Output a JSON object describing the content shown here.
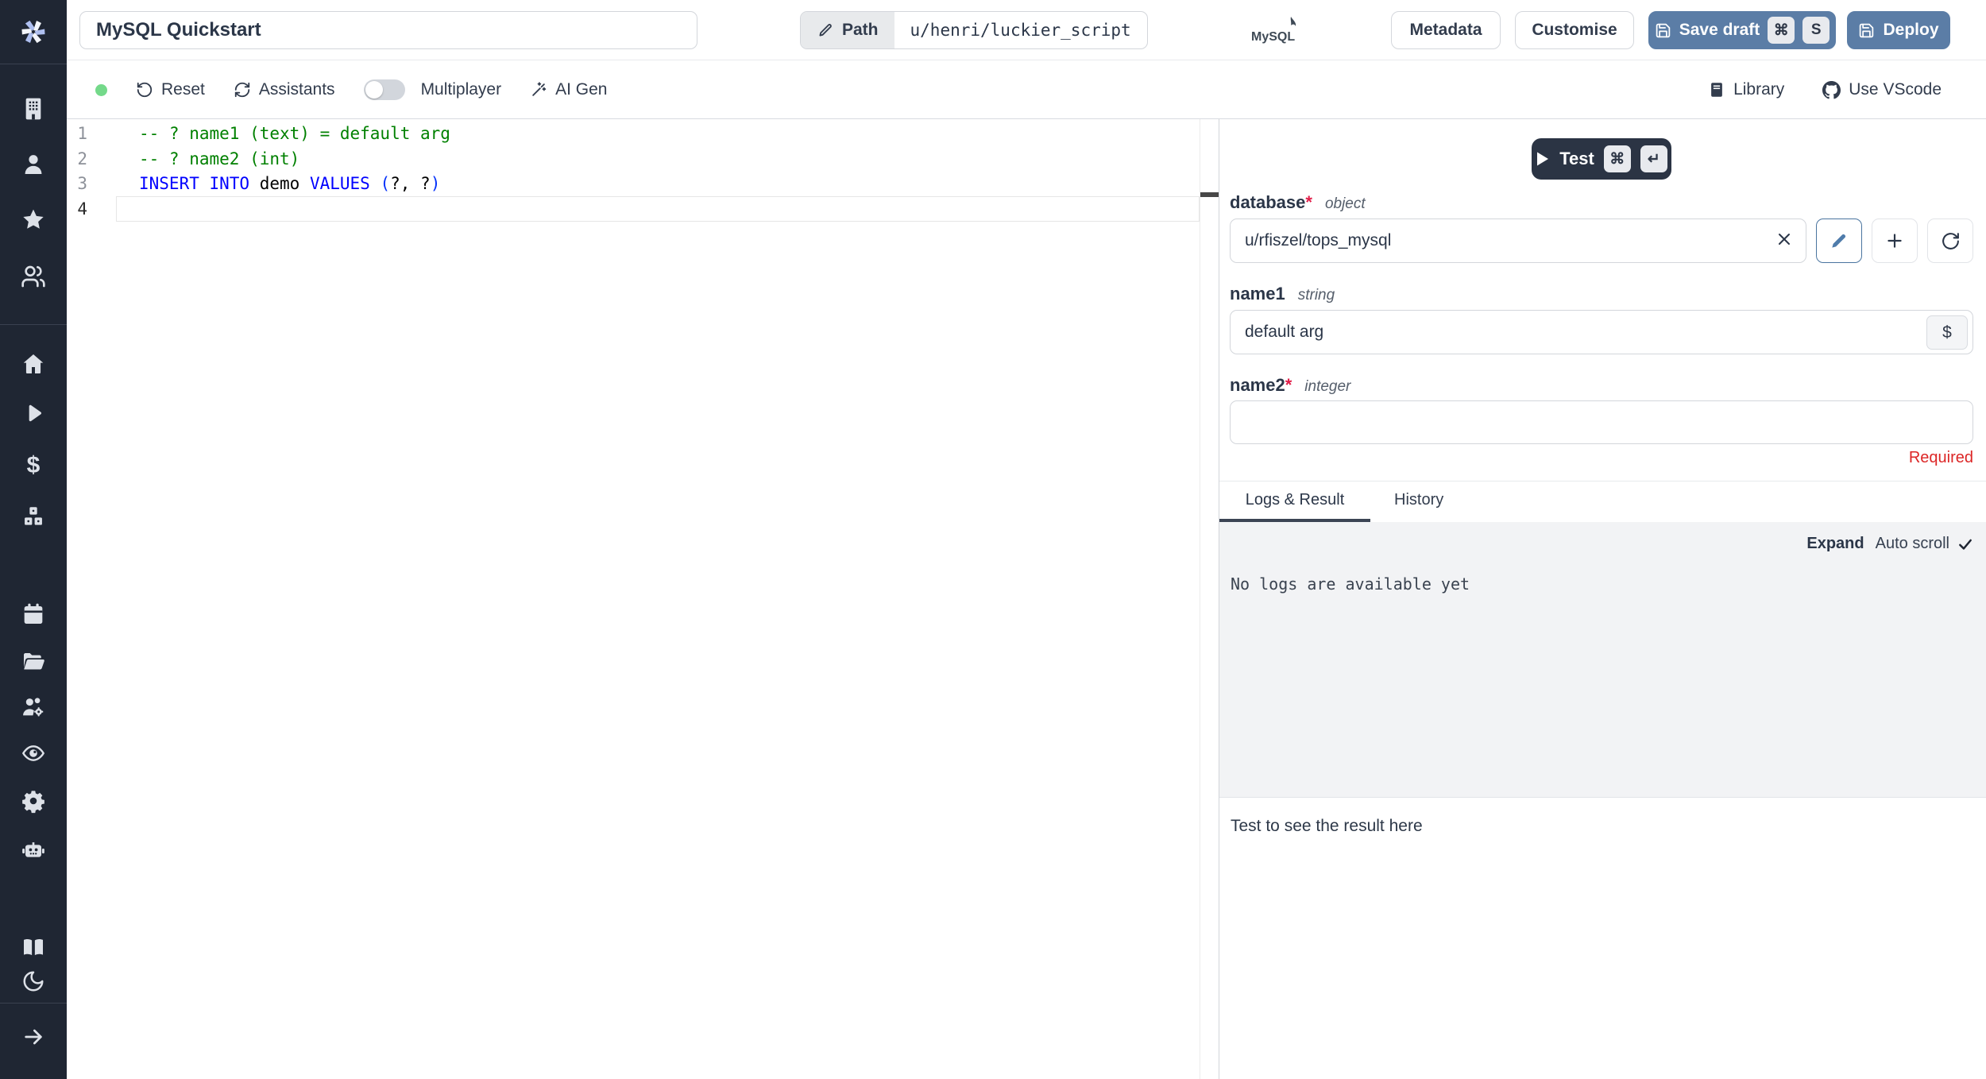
{
  "colors": {
    "sidebar_bg": "#1f2633",
    "accent_button": "#5b7da6",
    "dark_button": "#2b3444",
    "status_green": "#74d98a",
    "required_red": "#dc2626",
    "syntax_comment": "#008000",
    "syntax_keyword": "#0000ff",
    "syntax_bracket": "#0431fa",
    "syntax_plain": "#000000"
  },
  "sidebar": {
    "icons": [
      "windmill-logo",
      "building",
      "person",
      "star",
      "users-group",
      "home",
      "play",
      "dollar",
      "cubes",
      "calendar",
      "folder-open",
      "users-gear",
      "eye",
      "gear",
      "robot",
      "book-open",
      "moon",
      "arrow-right"
    ]
  },
  "topbar": {
    "title_value": "MySQL Quickstart",
    "path_label": "Path",
    "path_value": "u/henri/luckier_script",
    "language_badge": "MySQL",
    "metadata_label": "Metadata",
    "customise_label": "Customise",
    "save_draft_label": "Save draft",
    "save_key_1": "⌘",
    "save_key_2": "S",
    "deploy_label": "Deploy"
  },
  "toolbar": {
    "reset_label": "Reset",
    "assistants_label": "Assistants",
    "multiplayer_label": "Multiplayer",
    "multiplayer_on": false,
    "ai_gen_label": "AI Gen",
    "library_label": "Library",
    "vscode_label": "Use VScode"
  },
  "editor": {
    "active_line": "4",
    "lines": [
      {
        "number": "1",
        "segments": [
          {
            "text": "-- ? name1 (text) = default arg"
          }
        ]
      },
      {
        "number": "2",
        "segments": [
          {
            "text": "-- ? name2 (int)"
          }
        ]
      },
      {
        "number": "3",
        "segments": [
          {
            "text": "INSERT INTO"
          },
          {
            "text": " demo "
          },
          {
            "text": "VALUES"
          },
          {
            "text": " "
          },
          {
            "text": "("
          },
          {
            "text": "?, ?"
          },
          {
            "text": ")"
          }
        ]
      },
      {
        "number": "4",
        "segments": []
      }
    ]
  },
  "run_panel": {
    "test": {
      "label": "Test",
      "key_1": "⌘",
      "key_2": "↵"
    },
    "fields": [
      {
        "name": "database",
        "required": "*",
        "type": "object",
        "value": "u/rfiszel/tops_mysql"
      },
      {
        "name": "name1",
        "required": "",
        "type": "string",
        "value": "default arg",
        "suffix_button": "$"
      },
      {
        "name": "name2",
        "required": "*",
        "type": "integer",
        "value": "",
        "error": "Required"
      }
    ],
    "tabs": [
      {
        "label": "Logs & Result",
        "active": true
      },
      {
        "label": "History",
        "active": false
      }
    ],
    "logs": {
      "expand_label": "Expand",
      "autoscroll_label": "Auto scroll",
      "empty_message": "No logs are available yet"
    },
    "result_placeholder": "Test to see the result here"
  }
}
